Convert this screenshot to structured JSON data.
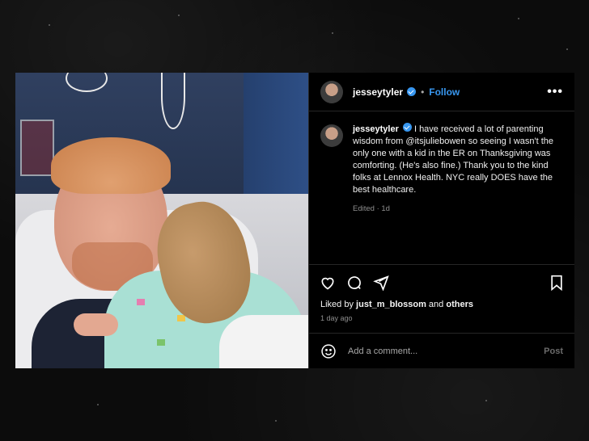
{
  "colors": {
    "accent": "#3897f0",
    "background": "#000000",
    "border": "#262626",
    "muted": "#8e8e8e"
  },
  "header": {
    "username": "jesseytyler",
    "separator": "•",
    "follow_label": "Follow",
    "more_label": "•••",
    "avatar_icon": "avatar-icon",
    "verified_icon": "verified-badge-icon"
  },
  "caption": {
    "username": "jesseytyler",
    "text": "I have received a lot of parenting wisdom from @itsjuliebowen so seeing I wasn't the only one with a kid in the ER on Thanksgiving was comforting. (He's also fine.) Thank you to the kind folks at Lennox Health. NYC really DOES have the best healthcare.",
    "edited": "Edited",
    "dot": "·",
    "age": "1d"
  },
  "actions": {
    "like_icon": "heart-icon",
    "comment_icon": "comment-icon",
    "share_icon": "share-icon",
    "save_icon": "bookmark-icon"
  },
  "likes": {
    "prefix": "Liked by",
    "user": "just_m_blossom",
    "conj": "and",
    "others": "others"
  },
  "timestamp": "1 day ago",
  "comment": {
    "emoji_icon": "emoji-icon",
    "placeholder": "Add a comment...",
    "post_label": "Post"
  }
}
